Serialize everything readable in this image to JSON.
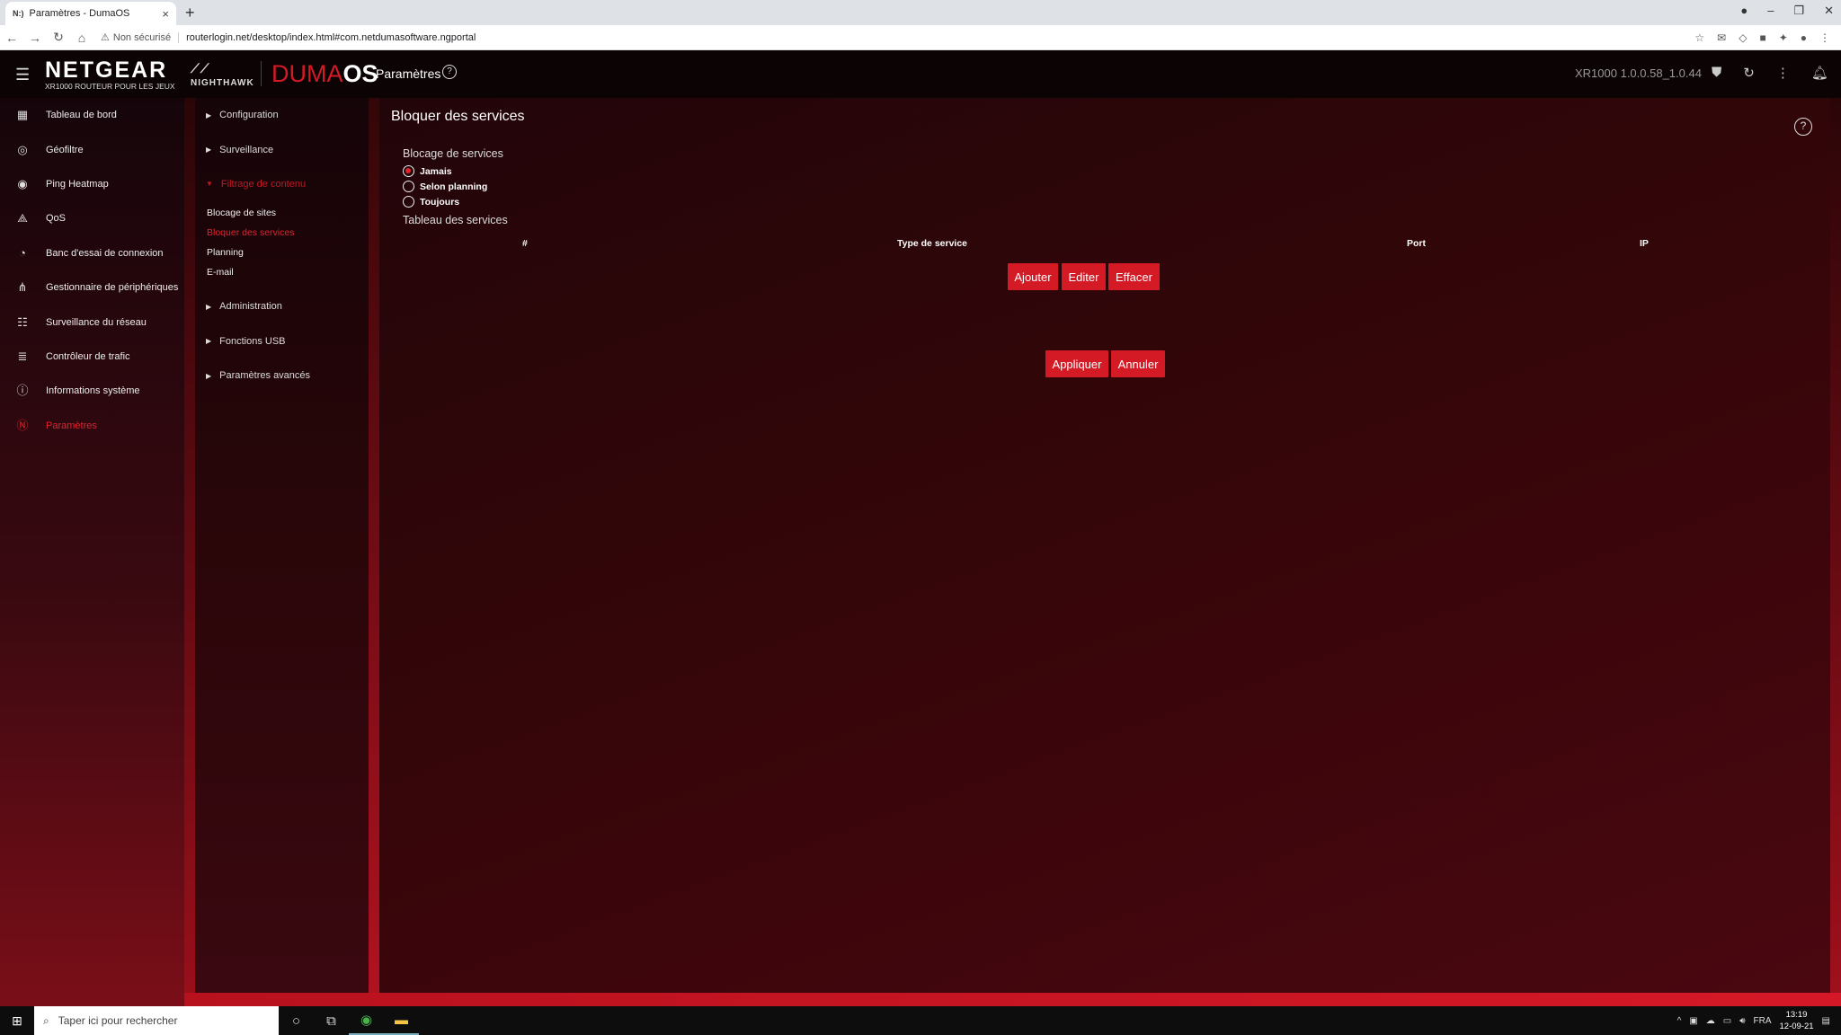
{
  "browser": {
    "tab_favicon": "N:)",
    "tab_title": "Paramètres - DumaOS",
    "tab_close": "×",
    "new_tab": "+",
    "not_secure": "Non sécurisé",
    "url": "routerlogin.net/desktop/index.html#com.netdumasoftware.ngportal"
  },
  "header": {
    "brand": "NETGEAR",
    "brand_sub": "XR1000 ROUTEUR POUR LES JEUX",
    "nighthawk": "NIGHTHAWK",
    "duma_red": "DUMA",
    "duma_white": "OS",
    "title": "Paramètres",
    "version": "XR1000 1.0.0.58_1.0.44"
  },
  "sidebar": {
    "items": [
      {
        "label": "Tableau de bord",
        "icon": "dashboard-icon"
      },
      {
        "label": "Géofiltre",
        "icon": "geofilter-icon"
      },
      {
        "label": "Ping Heatmap",
        "icon": "ping-heatmap-icon"
      },
      {
        "label": "QoS",
        "icon": "qos-icon"
      },
      {
        "label": "Banc d'essai de connexion",
        "icon": "speedometer-icon"
      },
      {
        "label": "Gestionnaire de périphériques",
        "icon": "device-tree-icon"
      },
      {
        "label": "Surveillance du réseau",
        "icon": "network-monitor-icon"
      },
      {
        "label": "Contrôleur de trafic",
        "icon": "traffic-controller-icon"
      },
      {
        "label": "Informations système",
        "icon": "system-info-icon"
      },
      {
        "label": "Paramètres",
        "icon": "settings-icon"
      }
    ]
  },
  "subnav": {
    "configuration": "Configuration",
    "surveillance": "Surveillance",
    "filtrage": "Filtrage de contenu",
    "filtrage_items": [
      "Blocage de sites",
      "Bloquer des services",
      "Planning",
      "E-mail"
    ],
    "administration": "Administration",
    "usb": "Fonctions USB",
    "avances": "Paramètres avancés"
  },
  "main": {
    "title": "Bloquer des services",
    "blocking_label": "Blocage de services",
    "options": [
      "Jamais",
      "Selon planning",
      "Toujours"
    ],
    "selected_option": "Jamais",
    "table_label": "Tableau des services",
    "columns": [
      "#",
      "Type de service",
      "Port",
      "IP"
    ],
    "rows": [],
    "buttons": {
      "add": "Ajouter",
      "edit": "Editer",
      "delete": "Effacer",
      "apply": "Appliquer",
      "cancel": "Annuler"
    }
  },
  "taskbar": {
    "search_placeholder": "Taper ici pour rechercher",
    "lang": "FRA",
    "time": "13:19",
    "date": "12-09-21"
  },
  "colors": {
    "accent": "#d31a25",
    "active_text": "#e2232e"
  }
}
